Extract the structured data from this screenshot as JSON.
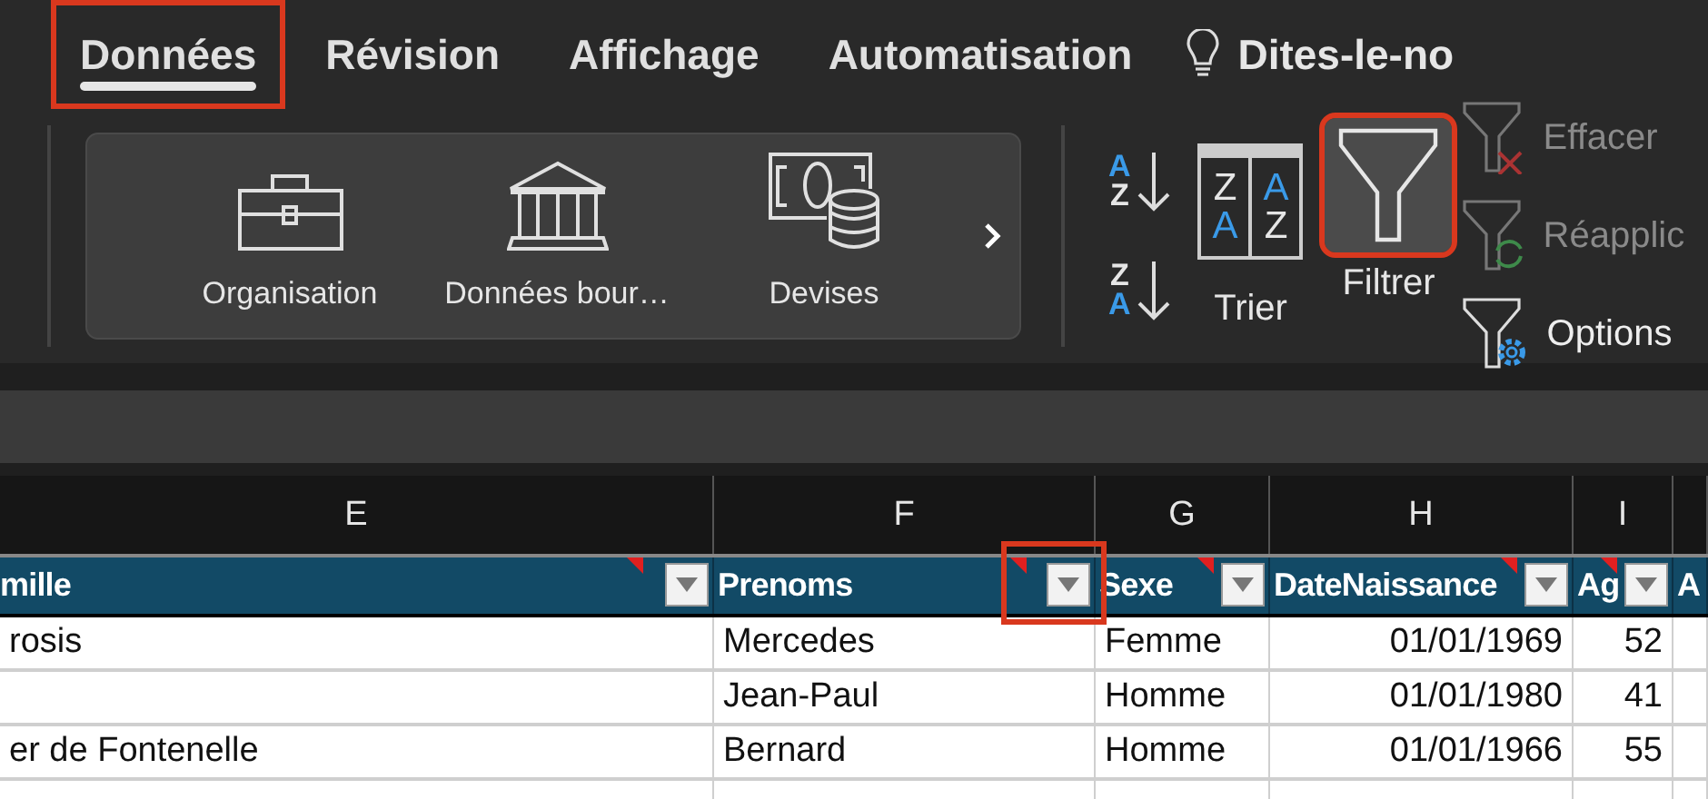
{
  "tabs": [
    {
      "label": "Données",
      "selected": true,
      "highlighted": true
    },
    {
      "label": "Révision",
      "selected": false,
      "highlighted": false
    },
    {
      "label": "Affichage",
      "selected": false,
      "highlighted": false
    },
    {
      "label": "Automatisation",
      "selected": false,
      "highlighted": false
    }
  ],
  "tell_me": {
    "label": "Dites-le-no"
  },
  "data_types": [
    {
      "label": "Organisation",
      "kind": "briefcase"
    },
    {
      "label": "Données bour…",
      "kind": "bank"
    },
    {
      "label": "Devises",
      "kind": "currency"
    }
  ],
  "sort_buttons": [
    {
      "kind": "ascending",
      "letters": [
        "A",
        "Z"
      ]
    },
    {
      "kind": "descending",
      "letters": [
        "Z",
        "A"
      ]
    }
  ],
  "sort_dialog": {
    "label": "Trier",
    "left_letters": [
      "Z",
      "A"
    ],
    "right_letters": [
      "A",
      "Z"
    ]
  },
  "filter": {
    "label": "Filtrer",
    "pressed": true,
    "highlighted": true
  },
  "filter_actions": [
    {
      "label": "Effacer",
      "kind": "clear",
      "disabled": true
    },
    {
      "label": "Réapplic",
      "kind": "reapply",
      "disabled": true
    },
    {
      "label": "Options",
      "kind": "options",
      "disabled": false
    }
  ],
  "column_letters": [
    "E",
    "F",
    "G",
    "H",
    "I"
  ],
  "table": {
    "columns": [
      {
        "label": "mille",
        "comment": true,
        "highlighted": false
      },
      {
        "label": "Prenoms",
        "comment": true,
        "highlighted": true
      },
      {
        "label": "Sexe",
        "comment": true,
        "highlighted": false
      },
      {
        "label": "DateNaissance",
        "comment": true,
        "highlighted": false
      },
      {
        "label": "Ag",
        "comment": true,
        "highlighted": false
      },
      {
        "label": "A"
      }
    ],
    "rows": [
      [
        "rosis",
        "Mercedes",
        "Femme",
        "01/01/1969",
        "52"
      ],
      [
        null,
        "Jean-Paul",
        "Homme",
        "01/01/1980",
        "41"
      ],
      [
        "er de Fontenelle",
        "Bernard",
        "Homme",
        "01/01/1966",
        "55"
      ]
    ]
  }
}
